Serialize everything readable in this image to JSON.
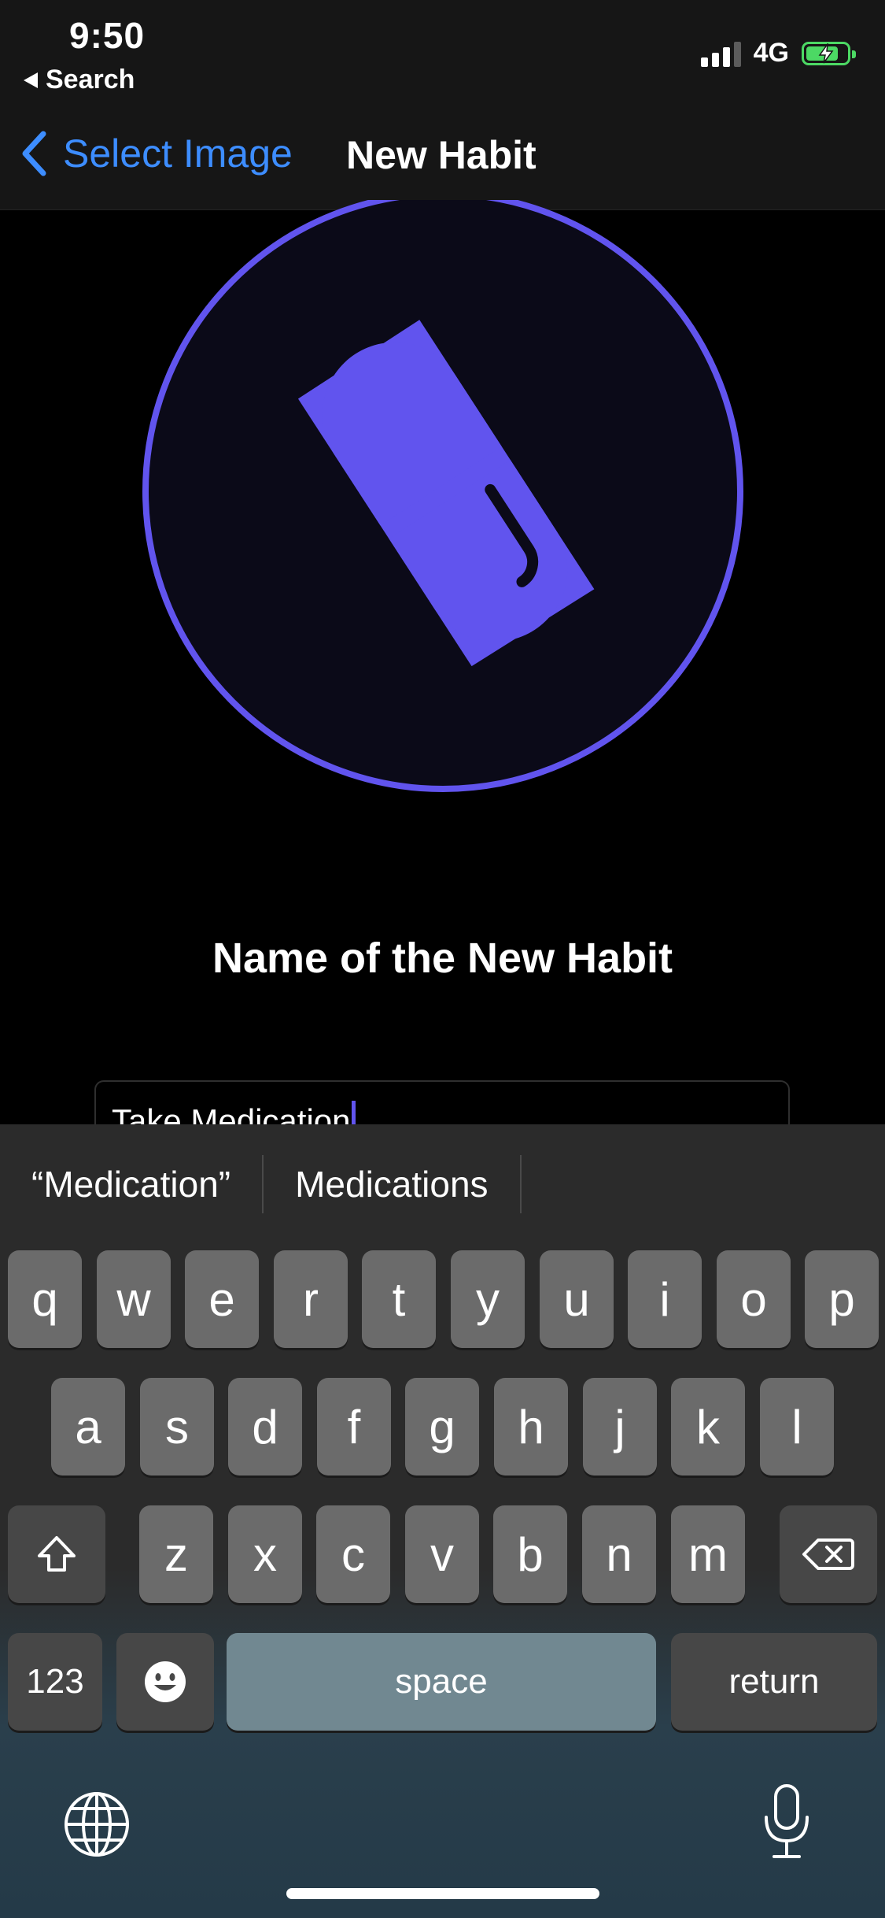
{
  "status_bar": {
    "time": "9:50",
    "back_app_label": "Search",
    "network": "4G",
    "battery_state": "charging",
    "battery_level_percent": 80
  },
  "nav": {
    "back_label": "Select Image",
    "title": "New Habit"
  },
  "habit_icon": {
    "icon_name": "pill-icon",
    "accent_color": "#6154ee",
    "circle_fill": "#0b0a18"
  },
  "form": {
    "heading": "Name of the New Habit",
    "name_value": "Take Medication"
  },
  "keyboard": {
    "suggestions": [
      "“Medication”",
      "Medications"
    ],
    "row1": [
      "q",
      "w",
      "e",
      "r",
      "t",
      "y",
      "u",
      "i",
      "o",
      "p"
    ],
    "row2": [
      "a",
      "s",
      "d",
      "f",
      "g",
      "h",
      "j",
      "k",
      "l"
    ],
    "row3": [
      "z",
      "x",
      "c",
      "v",
      "b",
      "n",
      "m"
    ],
    "numbers_label": "123",
    "space_label": "space",
    "return_label": "return",
    "icons": {
      "shift": "shift-icon",
      "delete": "delete-icon",
      "emoji": "emoji-icon",
      "globe": "globe-icon",
      "mic": "microphone-icon"
    }
  }
}
